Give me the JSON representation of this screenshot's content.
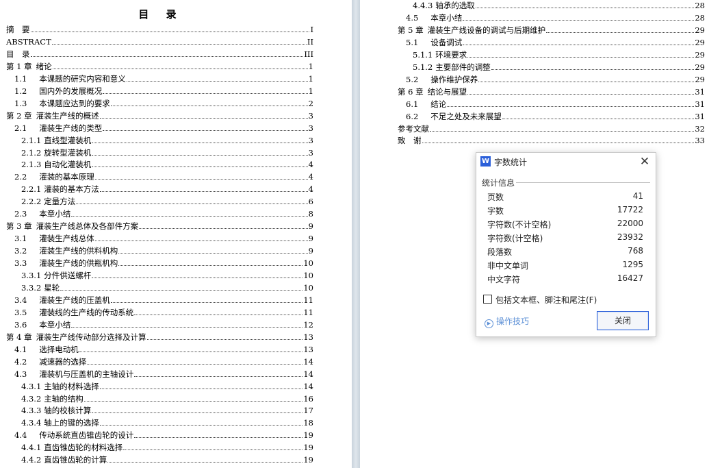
{
  "toc": {
    "title": "目 录",
    "left": [
      {
        "num": "摘　要",
        "text": "",
        "page": "I",
        "indent": 0
      },
      {
        "num": "ABSTRACT",
        "text": "",
        "page": "II",
        "indent": 0
      },
      {
        "num": "目　录",
        "text": "",
        "page": "III",
        "indent": 0
      },
      {
        "num": "第 1 章",
        "text": "绪论",
        "page": "1",
        "indent": 0
      },
      {
        "num": "1.1",
        "text": "本课题的研究内容和意义",
        "page": "1",
        "indent": 1
      },
      {
        "num": "1.2",
        "text": "国内外的发展概况",
        "page": "1",
        "indent": 1
      },
      {
        "num": "1.3",
        "text": "本课题应达到的要求",
        "page": "2",
        "indent": 1
      },
      {
        "num": "第 2 章",
        "text": "灌装生产线的概述",
        "page": "3",
        "indent": 0
      },
      {
        "num": "2.1",
        "text": "灌装生产线的类型",
        "page": "3",
        "indent": 1
      },
      {
        "num": "2.1.1",
        "text": "直线型灌装机",
        "page": "3",
        "indent": 2
      },
      {
        "num": "2.1.2",
        "text": "旋转型灌装机",
        "page": "3",
        "indent": 2
      },
      {
        "num": "2.1.3",
        "text": "自动化灌装机",
        "page": "4",
        "indent": 2
      },
      {
        "num": "2.2",
        "text": "灌装的基本原理",
        "page": "4",
        "indent": 1
      },
      {
        "num": "2.2.1",
        "text": "灌装的基本方法",
        "page": "4",
        "indent": 2
      },
      {
        "num": "2.2.2",
        "text": "定量方法",
        "page": "6",
        "indent": 2
      },
      {
        "num": "2.3",
        "text": "本章小结",
        "page": "8",
        "indent": 1
      },
      {
        "num": "第 3 章",
        "text": "灌装生产线总体及各部件方案",
        "page": "9",
        "indent": 0
      },
      {
        "num": "3.1",
        "text": "灌装生产线总体",
        "page": "9",
        "indent": 1
      },
      {
        "num": "3.2",
        "text": "灌装生产线的供料机构",
        "page": "9",
        "indent": 1
      },
      {
        "num": "3.3",
        "text": "灌装生产线的供瓶机构",
        "page": "10",
        "indent": 1
      },
      {
        "num": "3.3.1",
        "text": "分件供送螺杆",
        "page": "10",
        "indent": 2
      },
      {
        "num": "3.3.2",
        "text": "星轮",
        "page": "10",
        "indent": 2
      },
      {
        "num": "3.4",
        "text": "灌装生产线的压盖机",
        "page": "11",
        "indent": 1
      },
      {
        "num": "3.5",
        "text": "灌装线的生产线的传动系统",
        "page": "11",
        "indent": 1
      },
      {
        "num": "3.6",
        "text": "本章小结",
        "page": "12",
        "indent": 1
      },
      {
        "num": "第 4 章",
        "text": "灌装生产线传动部分选择及计算",
        "page": "13",
        "indent": 0
      },
      {
        "num": "4.1",
        "text": "选择电动机",
        "page": "13",
        "indent": 1
      },
      {
        "num": "4.2",
        "text": "减速器的选择",
        "page": "14",
        "indent": 1
      },
      {
        "num": "4.3",
        "text": "灌装机与压盖机的主轴设计",
        "page": "14",
        "indent": 1
      },
      {
        "num": "4.3.1",
        "text": "主轴的材料选择",
        "page": "14",
        "indent": 2
      },
      {
        "num": "4.3.2",
        "text": "主轴的结构",
        "page": "16",
        "indent": 2
      },
      {
        "num": "4.3.3",
        "text": "轴的校核计算",
        "page": "17",
        "indent": 2
      },
      {
        "num": "4.3.4",
        "text": "轴上的键的选择",
        "page": "18",
        "indent": 2
      },
      {
        "num": "4.4",
        "text": "传动系统直齿锥齿轮的设计",
        "page": "19",
        "indent": 1
      },
      {
        "num": "4.4.1",
        "text": "直齿锥齿轮的材料选择",
        "page": "19",
        "indent": 2
      },
      {
        "num": "4.4.2",
        "text": "直齿锥齿轮的计算",
        "page": "19",
        "indent": 2
      }
    ],
    "right": [
      {
        "num": "4.4.3",
        "text": "轴承的选取",
        "page": "28",
        "indent": 2
      },
      {
        "num": "4.5",
        "text": "本章小结",
        "page": "28",
        "indent": 1
      },
      {
        "num": "第 5 章",
        "text": "灌装生产线设备的调试与后期维护",
        "page": "29",
        "indent": 0
      },
      {
        "num": "5.1",
        "text": "设备调试",
        "page": "29",
        "indent": 1
      },
      {
        "num": "5.1.1",
        "text": "环境要求",
        "page": "29",
        "indent": 2
      },
      {
        "num": "5.1.2",
        "text": "主要部件的调整",
        "page": "29",
        "indent": 2
      },
      {
        "num": "5.2",
        "text": "操作维护保养",
        "page": "29",
        "indent": 1
      },
      {
        "num": "第 6 章",
        "text": "结论与展望",
        "page": "31",
        "indent": 0
      },
      {
        "num": "6.1",
        "text": "结论",
        "page": "31",
        "indent": 1
      },
      {
        "num": "6.2",
        "text": "不足之处及未来展望",
        "page": "31",
        "indent": 1
      },
      {
        "num": "参考文献",
        "text": "",
        "page": "32",
        "indent": 0
      },
      {
        "num": "致　谢",
        "text": "",
        "page": "33",
        "indent": 0
      }
    ]
  },
  "dialog": {
    "app_icon": "wps-writer-icon",
    "logo_letter": "W",
    "title": "字数统计",
    "close_glyph": "✕",
    "group_label": "统计信息",
    "stats": [
      {
        "label": "页数",
        "value": "41"
      },
      {
        "label": "字数",
        "value": "17722"
      },
      {
        "label": "字符数(不计空格)",
        "value": "22000"
      },
      {
        "label": "字符数(计空格)",
        "value": "23932"
      },
      {
        "label": "段落数",
        "value": "768"
      },
      {
        "label": "非中文单词",
        "value": "1295"
      },
      {
        "label": "中文字符",
        "value": "16427"
      }
    ],
    "checkbox_label": "包括文本框、脚注和尾注(F)",
    "checkbox_checked": false,
    "tips_icon": "play-circle-icon",
    "tips_label": "操作技巧",
    "close_button_label": "关闭",
    "accent_color": "#2b5fd9",
    "tips_color": "#5b8fd6"
  }
}
